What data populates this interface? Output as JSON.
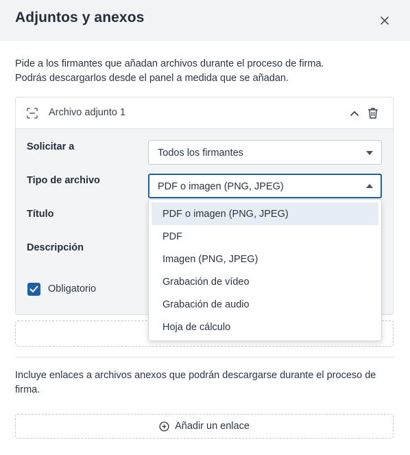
{
  "dialog": {
    "title": "Adjuntos y anexos",
    "close_icon": "close-icon",
    "description_line1": "Pide a los firmantes que añadan archivos durante el proceso de firma.",
    "description_line2": "Podrás descargarlos desde el panel a medida que se añadan."
  },
  "attachment": {
    "title": "Archivo adjunto 1",
    "request_label": "Solicitar a",
    "request_value": "Todos los firmantes",
    "file_type_label": "Tipo de archivo",
    "file_type_value": "PDF o imagen (PNG, JPEG)",
    "title_label": "Título",
    "description_label": "Descripción",
    "required_label": "Obligatorio",
    "required_checked": true
  },
  "file_type_options": [
    "PDF o imagen (PNG, JPEG)",
    "PDF",
    "Imagen (PNG, JPEG)",
    "Grabación de vídeo",
    "Grabación de audio",
    "Hoja de cálculo"
  ],
  "links": {
    "description": "Incluye enlaces a archivos anexos que podrán descargarse durante el proceso de firma.",
    "add_label": "Añadir un enlace"
  },
  "colors": {
    "accent": "#1f5fa8",
    "header_bg": "#f2f3f5",
    "selected_option_bg": "#e6edf5"
  }
}
